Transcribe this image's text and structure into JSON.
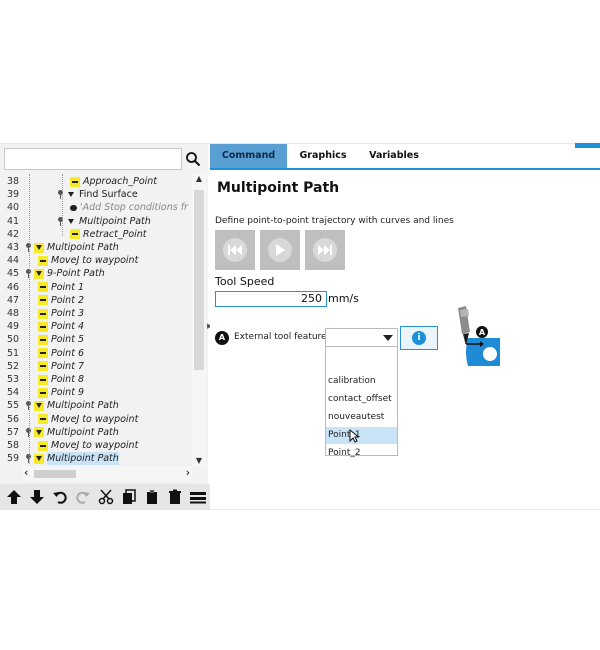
{
  "search": {
    "placeholder": "",
    "value": ""
  },
  "tree": {
    "rows": [
      {
        "num": "38",
        "label": "Approach_Point",
        "kind": "dash",
        "style": "it",
        "indent": 70
      },
      {
        "num": "39",
        "label": "Find Surface",
        "kind": "tri-pin",
        "style": "",
        "indent": 58
      },
      {
        "num": "40",
        "label": "'Add Stop conditions fr",
        "kind": "bubble",
        "style": "grey",
        "indent": 70
      },
      {
        "num": "41",
        "label": "Multipoint Path",
        "kind": "tri-pin",
        "style": "it",
        "indent": 58
      },
      {
        "num": "42",
        "label": "Retract_Point",
        "kind": "dash",
        "style": "it",
        "indent": 70
      },
      {
        "num": "43",
        "label": "Multipoint Path",
        "kind": "tri-pin",
        "style": "it",
        "indent": 26
      },
      {
        "num": "44",
        "label": "MoveJ to waypoint",
        "kind": "dash",
        "style": "it",
        "indent": 38
      },
      {
        "num": "45",
        "label": "9-Point Path",
        "kind": "tri-pin",
        "style": "it",
        "indent": 26
      },
      {
        "num": "46",
        "label": "Point 1",
        "kind": "dash",
        "style": "it",
        "indent": 38
      },
      {
        "num": "47",
        "label": "Point 2",
        "kind": "dash",
        "style": "it",
        "indent": 38
      },
      {
        "num": "48",
        "label": "Point 3",
        "kind": "dash",
        "style": "it",
        "indent": 38
      },
      {
        "num": "49",
        "label": "Point 4",
        "kind": "dash",
        "style": "it",
        "indent": 38
      },
      {
        "num": "50",
        "label": "Point 5",
        "kind": "dash",
        "style": "it",
        "indent": 38
      },
      {
        "num": "51",
        "label": "Point 6",
        "kind": "dash",
        "style": "it",
        "indent": 38
      },
      {
        "num": "52",
        "label": "Point 7",
        "kind": "dash",
        "style": "it",
        "indent": 38
      },
      {
        "num": "53",
        "label": "Point 8",
        "kind": "dash",
        "style": "it",
        "indent": 38
      },
      {
        "num": "54",
        "label": "Point 9",
        "kind": "dash",
        "style": "it",
        "indent": 38
      },
      {
        "num": "55",
        "label": "Multipoint Path",
        "kind": "tri-pin",
        "style": "it",
        "indent": 26
      },
      {
        "num": "56",
        "label": "MoveJ to waypoint",
        "kind": "dash",
        "style": "it",
        "indent": 38
      },
      {
        "num": "57",
        "label": "Multipoint Path",
        "kind": "tri-pin",
        "style": "it",
        "indent": 26
      },
      {
        "num": "58",
        "label": "MoveJ to waypoint",
        "kind": "dash",
        "style": "it",
        "indent": 38
      },
      {
        "num": "59",
        "label": "Multipoint Path",
        "kind": "tri-pin",
        "style": "it",
        "indent": 26,
        "selected": true
      }
    ]
  },
  "tabs": [
    "Command",
    "Graphics",
    "Variables"
  ],
  "command": {
    "title": "Multipoint Path",
    "description": "Define point-to-point trajectory with curves and lines",
    "tool_speed_label": "Tool Speed",
    "tool_speed_value": "250",
    "tool_speed_unit": "mm/s",
    "badge": "A",
    "ext_label": "External tool feature",
    "ext_selected": "",
    "options": [
      "calibration",
      "contact_offset",
      "nouveautest",
      "Point_1",
      "Point_2"
    ],
    "highlighted_option": "Point_1",
    "info_label": "i",
    "illus_badge": "A"
  },
  "colors": {
    "accent": "#1e90d8",
    "tab_active": "#5a9fd4",
    "node_yellow": "#f6ea28",
    "illus_blue": "#1f8ad6"
  }
}
